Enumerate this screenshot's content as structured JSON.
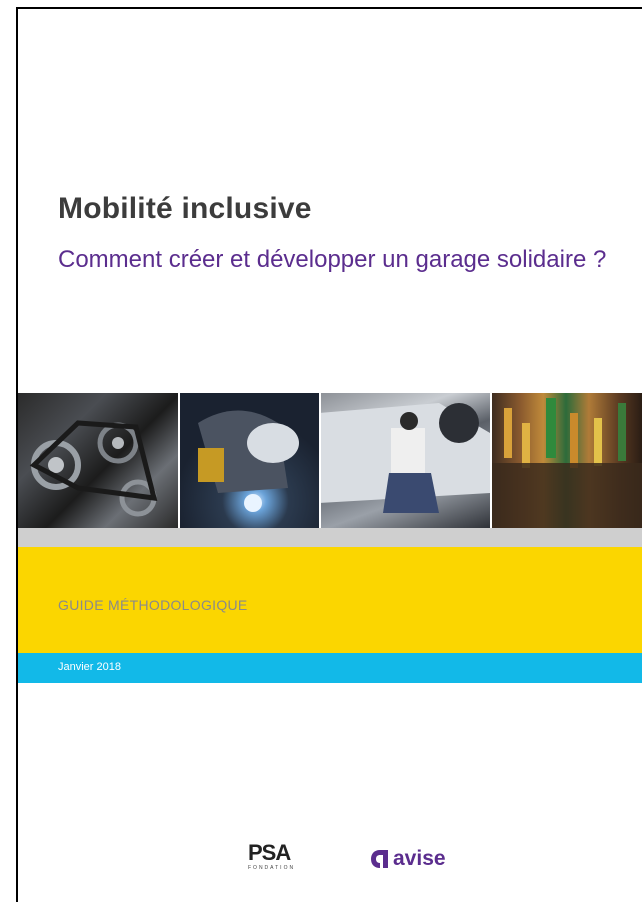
{
  "cover": {
    "title": "Mobilité inclusive",
    "subtitle": "Comment créer et développer un garage solidaire ?",
    "guide_label": "GUIDE MÉTHODOLOGIQUE",
    "date": "Janvier 2018"
  },
  "photos": [
    "engine-belts-photo",
    "welder-photo",
    "mechanic-car-photo",
    "tools-wall-photo"
  ],
  "logos": {
    "psa_text": "PSA",
    "psa_sub": "FONDATION",
    "avise_text": "avise"
  },
  "colors": {
    "title": "#3c3c3c",
    "subtitle": "#5b2d8e",
    "yellow_band": "#fbd600",
    "blue_band": "#12b9e8",
    "gray_band": "#cfcfcf"
  }
}
